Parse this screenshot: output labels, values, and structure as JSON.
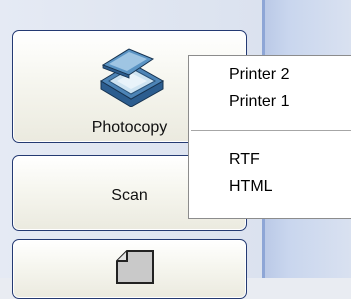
{
  "tools": {
    "photocopy": {
      "label": "Photocopy",
      "icon": "scanner-icon"
    },
    "scan": {
      "label": "Scan"
    },
    "third": {
      "icon": "document-page-icon"
    }
  },
  "menu": {
    "items": [
      {
        "label": "Printer 2"
      },
      {
        "label": "Printer 1"
      },
      {
        "label": "RTF"
      },
      {
        "label": "HTML"
      }
    ]
  },
  "colors": {
    "button_border": "#243a72",
    "panel_bg": "#dbe2ef",
    "menu_bg": "#ffffff",
    "strip_edge": "#8ea6d6"
  }
}
